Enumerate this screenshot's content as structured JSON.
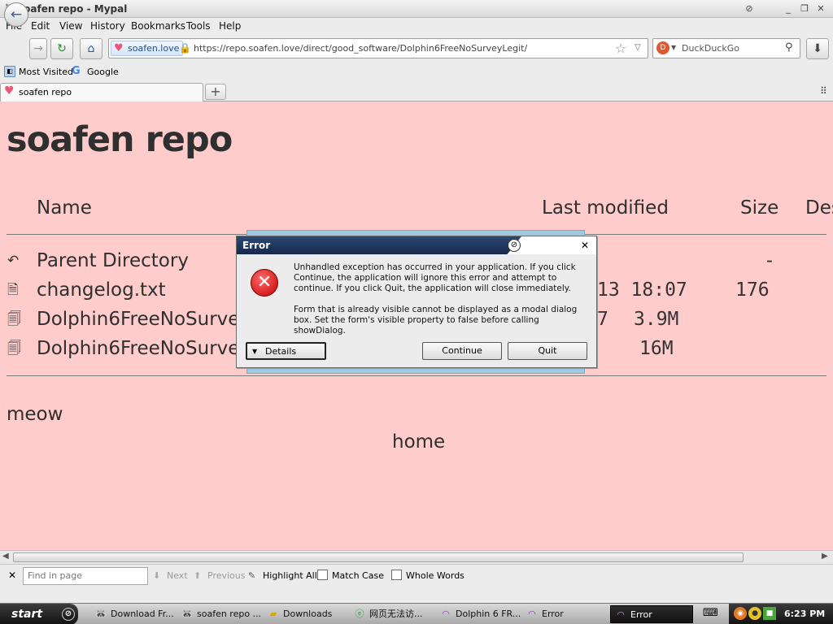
{
  "window": {
    "title": "soafen repo - Mypal"
  },
  "menu": [
    "File",
    "Edit",
    "View",
    "History",
    "Bookmarks",
    "Tools",
    "Help"
  ],
  "nav": {
    "identity": "soafen.love",
    "url": "https://repo.soafen.love/direct/good_software/Dolphin6FreeNoSurveyLegit/",
    "search_placeholder": "DuckDuckGo"
  },
  "bookmarks": [
    "Most Visited",
    "Google"
  ],
  "tab": {
    "label": "soafen repo",
    "new_tab": "+"
  },
  "page": {
    "heading": "soafen repo",
    "columns": {
      "name": "Name",
      "modified": "Last modified",
      "size": "Size",
      "desc": "Des"
    },
    "rows": [
      {
        "name": "Parent Directory",
        "modified": "",
        "size": "-"
      },
      {
        "name": "changelog.txt",
        "modified": "13 18:07",
        "size": "176"
      },
      {
        "name": "Dolphin6FreeNoSurveyL",
        "modified": "7",
        "size": "3.9M"
      },
      {
        "name": "Dolphin6FreeNoSurveyL",
        "modified": "",
        "size": "16M"
      }
    ],
    "footer_left": "meow",
    "footer_link": "home"
  },
  "dialog": {
    "title": "Error",
    "message1": "Unhandled exception has occurred in your application. If you click Continue, the application will ignore this error and attempt to continue. If you click Quit, the application will close immediately.",
    "message2": "Form that is already visible cannot be displayed as a modal dialog box. Set the form's visible property to false before calling showDialog.",
    "details": "Details",
    "continue": "Continue",
    "quit": "Quit"
  },
  "findbar": {
    "placeholder": "Find in page",
    "next": "Next",
    "previous": "Previous",
    "highlight": "Highlight All",
    "match_case": "Match Case",
    "whole_words": "Whole Words"
  },
  "taskbar": {
    "start": "start",
    "tasks": [
      "Download Fr...",
      "soafen repo ...",
      "Downloads",
      "网页无法访...",
      "Dolphin 6 FR...",
      "Error",
      "Error"
    ],
    "clock": "6:23 PM"
  },
  "colors": {
    "page_bg": "#ffcccc",
    "dialog_title": "#1f3459",
    "error_red": "#c40000"
  }
}
